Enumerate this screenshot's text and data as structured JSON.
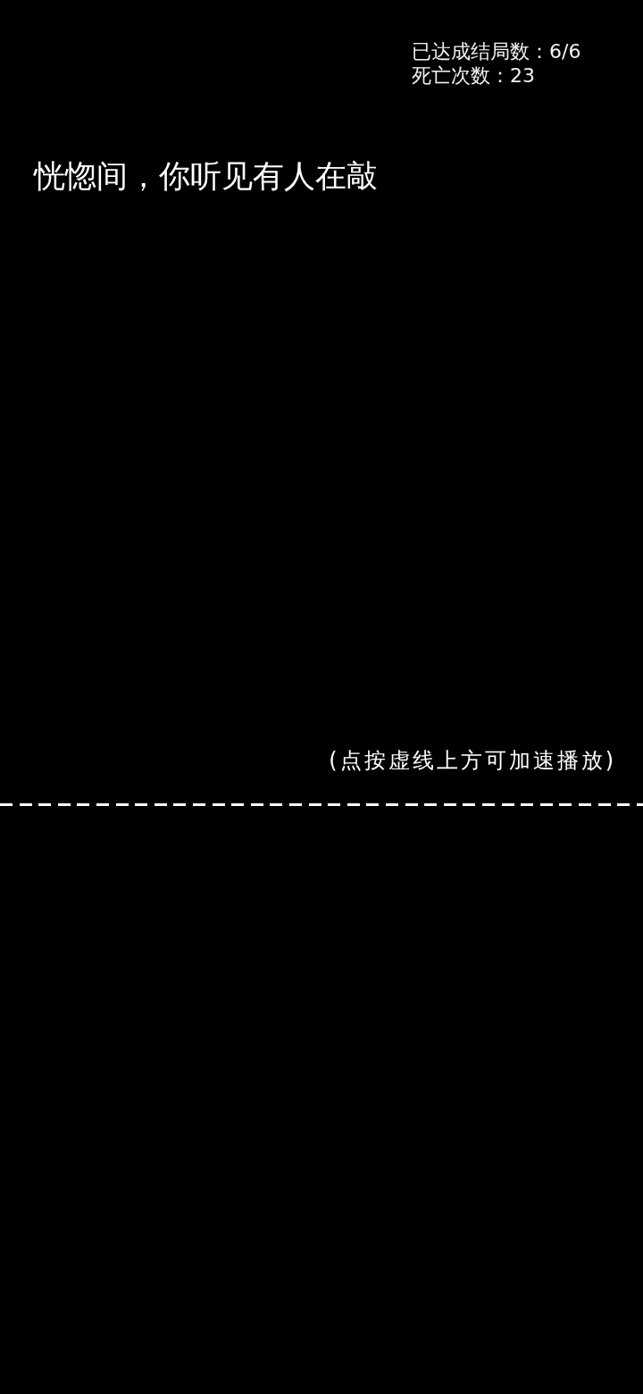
{
  "counters": [
    "已达成结局数：6/6",
    "死亡次数：23"
  ],
  "story_text": "恍惚间，你听见有人在敲",
  "hint": "(点按虚线上方可加速播放)"
}
